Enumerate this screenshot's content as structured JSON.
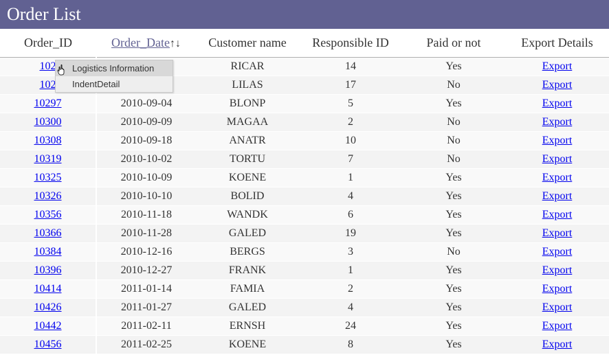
{
  "header": {
    "title": "Order List"
  },
  "columns": {
    "order_id": "Order_ID",
    "order_date": "Order_Date",
    "sort_arrows": "↑↓",
    "customer": "Customer name",
    "responsible": "Responsible ID",
    "paid": "Paid or not",
    "export": "Export Details"
  },
  "export_label": "Export",
  "context_menu": {
    "item1": "Logistics Information",
    "item2": "IndentDetail"
  },
  "rows": [
    {
      "id": "102",
      "date": "",
      "customer": "RICAR",
      "responsible": "14",
      "paid": "Yes"
    },
    {
      "id": "102",
      "date": "",
      "customer": "LILAS",
      "responsible": "17",
      "paid": "No"
    },
    {
      "id": "10297",
      "date": "2010-09-04",
      "customer": "BLONP",
      "responsible": "5",
      "paid": "Yes"
    },
    {
      "id": "10300",
      "date": "2010-09-09",
      "customer": "MAGAA",
      "responsible": "2",
      "paid": "No"
    },
    {
      "id": "10308",
      "date": "2010-09-18",
      "customer": "ANATR",
      "responsible": "10",
      "paid": "No"
    },
    {
      "id": "10319",
      "date": "2010-10-02",
      "customer": "TORTU",
      "responsible": "7",
      "paid": "No"
    },
    {
      "id": "10325",
      "date": "2010-10-09",
      "customer": "KOENE",
      "responsible": "1",
      "paid": "Yes"
    },
    {
      "id": "10326",
      "date": "2010-10-10",
      "customer": "BOLID",
      "responsible": "4",
      "paid": "Yes"
    },
    {
      "id": "10356",
      "date": "2010-11-18",
      "customer": "WANDK",
      "responsible": "6",
      "paid": "Yes"
    },
    {
      "id": "10366",
      "date": "2010-11-28",
      "customer": "GALED",
      "responsible": "19",
      "paid": "Yes"
    },
    {
      "id": "10384",
      "date": "2010-12-16",
      "customer": "BERGS",
      "responsible": "3",
      "paid": "No"
    },
    {
      "id": "10396",
      "date": "2010-12-27",
      "customer": "FRANK",
      "responsible": "1",
      "paid": "Yes"
    },
    {
      "id": "10414",
      "date": "2011-01-14",
      "customer": "FAMIA",
      "responsible": "2",
      "paid": "Yes"
    },
    {
      "id": "10426",
      "date": "2011-01-27",
      "customer": "GALED",
      "responsible": "4",
      "paid": "Yes"
    },
    {
      "id": "10442",
      "date": "2011-02-11",
      "customer": "ERNSH",
      "responsible": "24",
      "paid": "Yes"
    },
    {
      "id": "10456",
      "date": "2011-02-25",
      "customer": "KOENE",
      "responsible": "8",
      "paid": "Yes"
    }
  ]
}
